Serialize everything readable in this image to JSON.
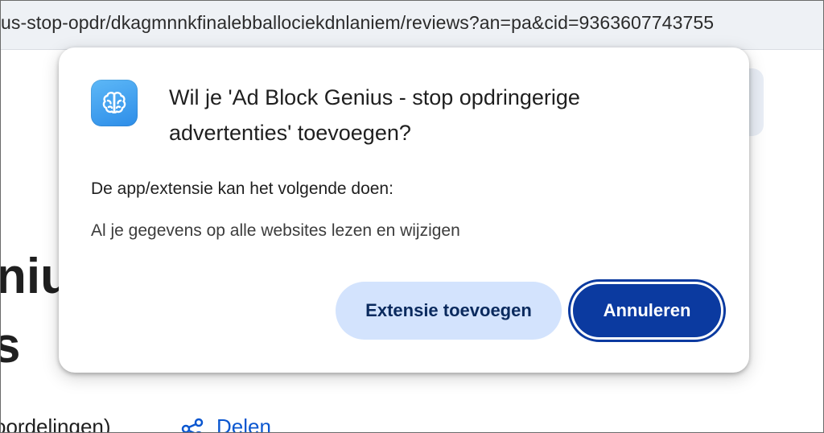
{
  "browser": {
    "url": "us-stop-opdr/dkagmnnkfinalebballociekdnlaniem/reviews?an=pa&cid=9363607743755"
  },
  "page": {
    "heading_line1": "niu",
    "heading_line2": "s",
    "ratings_text": "oordelingen)",
    "share_label": "Delen"
  },
  "dialog": {
    "icon": "brain-icon",
    "title": "Wil je 'Ad Block Genius - stop opdringerige advertenties' toevoegen?",
    "permissions_heading": "De app/extensie kan het volgende doen:",
    "permissions": [
      "Al je gegevens op alle websites lezen en wijzigen"
    ],
    "add_button": "Extensie toevoegen",
    "cancel_button": "Annuleren"
  },
  "colors": {
    "primary": "#0b3aa0",
    "secondary_button": "#d3e3fd",
    "icon_gradient": "#2d8de8",
    "link": "#0b57d0"
  }
}
